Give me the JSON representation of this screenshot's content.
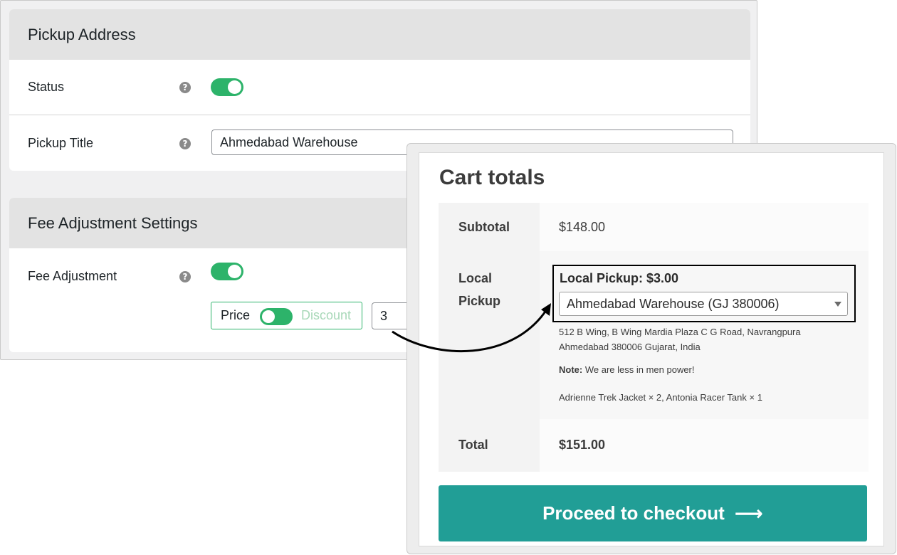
{
  "pickup_section": {
    "title": "Pickup Address",
    "status_label": "Status",
    "status_enabled": true,
    "pickup_title_label": "Pickup Title",
    "pickup_title_value": "Ahmedabad Warehouse"
  },
  "fee_section": {
    "title": "Fee Adjustment Settings",
    "fee_label": "Fee Adjustment",
    "fee_enabled": true,
    "price_label": "Price",
    "discount_label": "Discount",
    "amount_value": "3"
  },
  "help_icon_glyph": "?",
  "cart": {
    "title": "Cart totals",
    "subtotal_label": "Subtotal",
    "subtotal_value": "$148.00",
    "local_pickup_label_line1": "Local",
    "local_pickup_label_line2": "Pickup",
    "pickup_heading": "Local Pickup: $3.00",
    "pickup_select_value": "Ahmedabad Warehouse (GJ 380006)",
    "address_line1": "512 B Wing, B Wing Mardia Plaza C G Road, Navrangpura",
    "address_line2": "Ahmedabad 380006 Gujarat, India",
    "note_label": "Note:",
    "note_text": "We are less in men power!",
    "items_text": "Adrienne Trek Jacket × 2, Antonia Racer Tank × 1",
    "total_label": "Total",
    "total_value": "$151.00",
    "checkout_label": "Proceed to checkout",
    "checkout_arrow": "⟶"
  },
  "colors": {
    "toggle_on": "#2db36a",
    "checkout_button": "#219e96",
    "section_header": "#e3e3e3"
  }
}
